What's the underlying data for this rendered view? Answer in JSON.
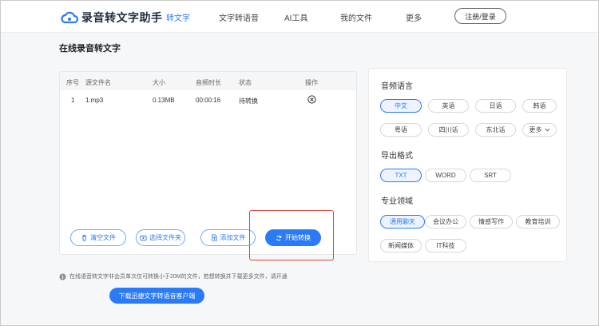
{
  "header": {
    "app_title": "录音转文字助手",
    "nav": [
      "转文字",
      "文字转语音",
      "AI工具",
      "我的文件",
      "更多"
    ],
    "active_index": 0,
    "login_label": "注册/登录"
  },
  "main": {
    "page_title": "在线录音转文字",
    "table": {
      "columns": [
        "序号",
        "源文件名",
        "大小",
        "音频时长",
        "状态",
        "操作"
      ],
      "rows": [
        {
          "index": "1",
          "name": "1.mp3",
          "size": "0.13MB",
          "duration": "00:00:16",
          "status": "待转换"
        }
      ]
    },
    "buttons": {
      "clear": "清空文件",
      "choose_folder": "选择文件夹",
      "add_file": "添加文件",
      "start": "开始转换"
    },
    "notice": "在线语音转文字非会员单次仅可转换小于20M的文件，若想转换并下载更多文件，请开通",
    "download_label": "下载迅捷文字转语音客户端"
  },
  "options": {
    "language_title": "音频语言",
    "languages": [
      "中文",
      "英语",
      "日语",
      "韩语",
      "粤语",
      "四川话",
      "东北话",
      "更多"
    ],
    "language_selected": "中文",
    "format_title": "导出格式",
    "formats": [
      "TXT",
      "WORD",
      "SRT"
    ],
    "format_selected": "TXT",
    "domain_title": "专业领域",
    "domains": [
      "通用聊天",
      "会议办公",
      "情感写作",
      "教育培训",
      "新闻媒体",
      "IT科技"
    ],
    "domain_selected": "通用聊天"
  },
  "colors": {
    "accent": "#2b7bf6",
    "highlight_box": "#e0453a"
  }
}
